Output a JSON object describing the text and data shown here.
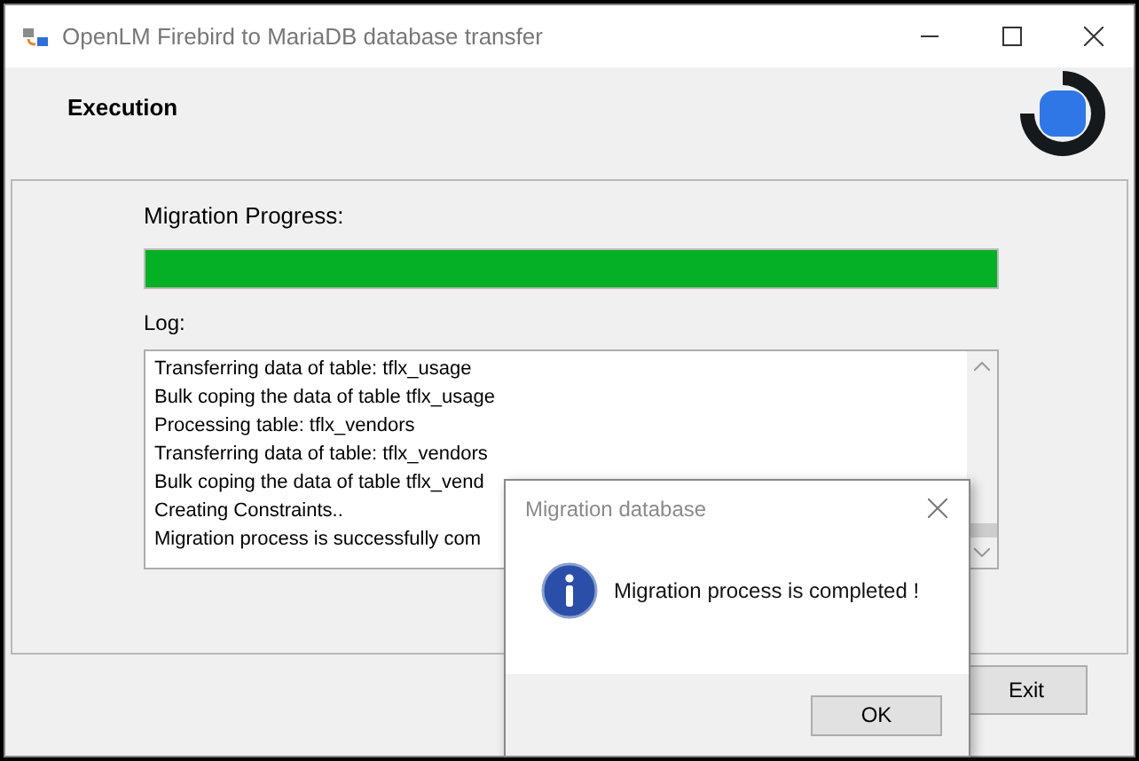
{
  "window": {
    "title": "OpenLM Firebird to MariaDB database transfer"
  },
  "header": {
    "title": "Execution"
  },
  "progress": {
    "label": "Migration Progress:",
    "level": 1
  },
  "log": {
    "label": "Log:",
    "lines": [
      "Transferring data of table: tflx_usage",
      "Bulk coping the data of table tflx_usage",
      "Processing table: tflx_vendors",
      "Transferring data of table: tflx_vendors",
      "Bulk coping the data of table tflx_vend",
      "Creating Constraints..",
      "Migration process is successfully com"
    ]
  },
  "buttons": [
    {
      "label": "Exit"
    }
  ],
  "dialog": {
    "title": "Migration database",
    "message": "Migration process is completed !",
    "buttons": [
      {
        "label": "OK"
      }
    ]
  }
}
